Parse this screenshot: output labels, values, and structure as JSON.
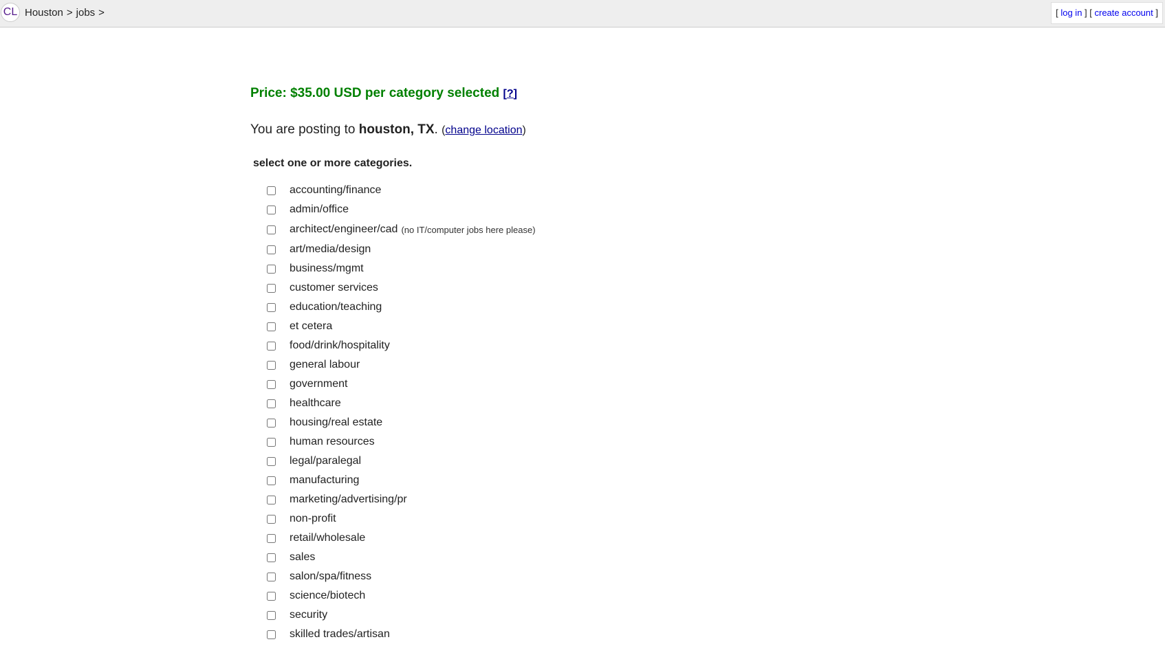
{
  "header": {
    "logo_text": "CL",
    "breadcrumbs": [
      {
        "label": "Houston"
      },
      {
        "label": "jobs"
      }
    ],
    "crumb_separator": ">",
    "login_label": "log in",
    "create_account_label": "create account"
  },
  "main": {
    "price_text": "Price: $35.00 USD per category selected",
    "price_help_label": "?",
    "posting_prefix": "You are posting to",
    "posting_location": "houston, TX",
    "change_location_label": "change location",
    "categories_heading": "select one or more categories.",
    "categories": [
      {
        "label": "accounting/finance",
        "note": "",
        "checked": false
      },
      {
        "label": "admin/office",
        "note": "",
        "checked": false
      },
      {
        "label": "architect/engineer/cad",
        "note": "(no IT/computer jobs here please)",
        "checked": false
      },
      {
        "label": "art/media/design",
        "note": "",
        "checked": false
      },
      {
        "label": "business/mgmt",
        "note": "",
        "checked": false
      },
      {
        "label": "customer services",
        "note": "",
        "checked": false
      },
      {
        "label": "education/teaching",
        "note": "",
        "checked": false
      },
      {
        "label": "et cetera",
        "note": "",
        "checked": false
      },
      {
        "label": "food/drink/hospitality",
        "note": "",
        "checked": false
      },
      {
        "label": "general labour",
        "note": "",
        "checked": false
      },
      {
        "label": "government",
        "note": "",
        "checked": false
      },
      {
        "label": "healthcare",
        "note": "",
        "checked": false
      },
      {
        "label": "housing/real estate",
        "note": "",
        "checked": false
      },
      {
        "label": "human resources",
        "note": "",
        "checked": false
      },
      {
        "label": "legal/paralegal",
        "note": "",
        "checked": false
      },
      {
        "label": "manufacturing",
        "note": "",
        "checked": false
      },
      {
        "label": "marketing/advertising/pr",
        "note": "",
        "checked": false
      },
      {
        "label": "non-profit",
        "note": "",
        "checked": false
      },
      {
        "label": "retail/wholesale",
        "note": "",
        "checked": false
      },
      {
        "label": "sales",
        "note": "",
        "checked": false
      },
      {
        "label": "salon/spa/fitness",
        "note": "",
        "checked": false
      },
      {
        "label": "science/biotech",
        "note": "",
        "checked": false
      },
      {
        "label": "security",
        "note": "",
        "checked": false
      },
      {
        "label": "skilled trades/artisan",
        "note": "",
        "checked": false
      }
    ]
  },
  "colors": {
    "price_green": "#008000",
    "link_blue": "#00008b",
    "header_bg": "#eeeeee"
  }
}
